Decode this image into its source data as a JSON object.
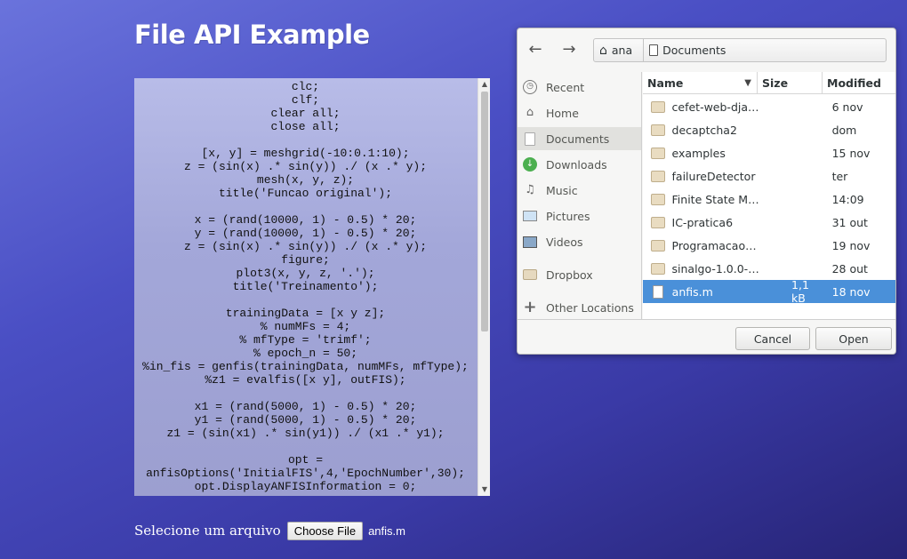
{
  "page": {
    "title": "File API Example",
    "code_lines": [
      "clc;",
      "clf;",
      "clear all;",
      "close all;",
      "",
      "[x, y] = meshgrid(-10:0.1:10);",
      "z = (sin(x) .* sin(y)) ./ (x .* y);",
      "mesh(x, y, z);",
      "title('Funcao original');",
      "",
      "x = (rand(10000, 1) - 0.5) * 20;",
      "y = (rand(10000, 1) - 0.5) * 20;",
      "z = (sin(x) .* sin(y)) ./ (x .* y);",
      "figure;",
      "plot3(x, y, z, '.');",
      "title('Treinamento');",
      "",
      "trainingData = [x y z];",
      "% numMFs = 4;",
      "% mfType = 'trimf';",
      "% epoch_n = 50;",
      "%in_fis = genfis(trainingData, numMFs, mfType);",
      "%z1 = evalfis([x y], outFIS);",
      "",
      "x1 = (rand(5000, 1) - 0.5) * 20;",
      "y1 = (rand(5000, 1) - 0.5) * 20;",
      "z1 = (sin(x1) .* sin(y1)) ./ (x1 .* y1);",
      "",
      "opt =",
      "anfisOptions('InitialFIS',4,'EpochNumber',30);",
      "opt.DisplayANFISInformation = 0;"
    ],
    "file_input": {
      "label": "Selecione um arquivo",
      "button": "Choose File",
      "file_name": "anfis.m"
    }
  },
  "dialog": {
    "path": [
      "ana",
      "Documents"
    ],
    "sidebar": [
      {
        "label": "Recent",
        "icon": "clock-icon"
      },
      {
        "label": "Home",
        "icon": "home-icon"
      },
      {
        "label": "Documents",
        "icon": "document-icon"
      },
      {
        "label": "Downloads",
        "icon": "download-icon"
      },
      {
        "label": "Music",
        "icon": "music-icon"
      },
      {
        "label": "Pictures",
        "icon": "pictures-icon"
      },
      {
        "label": "Videos",
        "icon": "videos-icon"
      },
      {
        "label": "Dropbox",
        "icon": "folder-icon"
      },
      {
        "label": "Other Locations",
        "icon": "plus-icon"
      }
    ],
    "columns": {
      "name": "Name",
      "size": "Size",
      "modified": "Modified"
    },
    "rows": [
      {
        "name": "cefet-web-djan…",
        "size": "",
        "modified": "6 nov",
        "type": "folder"
      },
      {
        "name": "decaptcha2",
        "size": "",
        "modified": "dom",
        "type": "folder"
      },
      {
        "name": "examples",
        "size": "",
        "modified": "15 nov",
        "type": "folder"
      },
      {
        "name": "failureDetector",
        "size": "",
        "modified": "ter",
        "type": "folder"
      },
      {
        "name": "Finite State Ma…",
        "size": "",
        "modified": "14:09",
        "type": "folder"
      },
      {
        "name": "IC-pratica6",
        "size": "",
        "modified": "31 out",
        "type": "folder"
      },
      {
        "name": "Programacao…",
        "size": "",
        "modified": "19 nov",
        "type": "folder"
      },
      {
        "name": "sinalgo-1.0.0-b…",
        "size": "",
        "modified": "28 out",
        "type": "folder"
      },
      {
        "name": "anfis.m",
        "size": "1,1 kB",
        "modified": "18 nov",
        "type": "file",
        "selected": true
      }
    ],
    "buttons": {
      "cancel": "Cancel",
      "open": "Open"
    },
    "colors": {
      "selection": "#4a90d9"
    }
  }
}
